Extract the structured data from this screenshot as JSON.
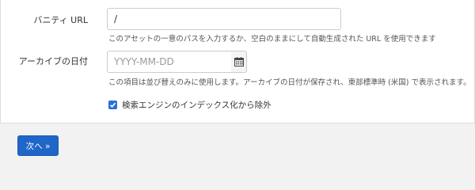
{
  "form": {
    "vanity_url": {
      "label": "バニティ URL",
      "value": "/",
      "help": "このアセットの一意のパスを入力するか、空白のままにして自動生成された URL を使用できます"
    },
    "archive_date": {
      "label": "アーカイブの日付",
      "placeholder": "YYYY-MM-DD",
      "calendar_icon": "calendar-icon",
      "help": "この項目は並び替えのみに使用します。アーカイブの日付が保存され、東部標準時 (米国) で表示されます。"
    },
    "exclude_search": {
      "label": "検索エンジンのインデックス化から除外",
      "checked": true
    }
  },
  "footer": {
    "next_label": "次へ »"
  },
  "colors": {
    "primary": "#1f66c9",
    "checkbox": "#2a6ed8"
  }
}
